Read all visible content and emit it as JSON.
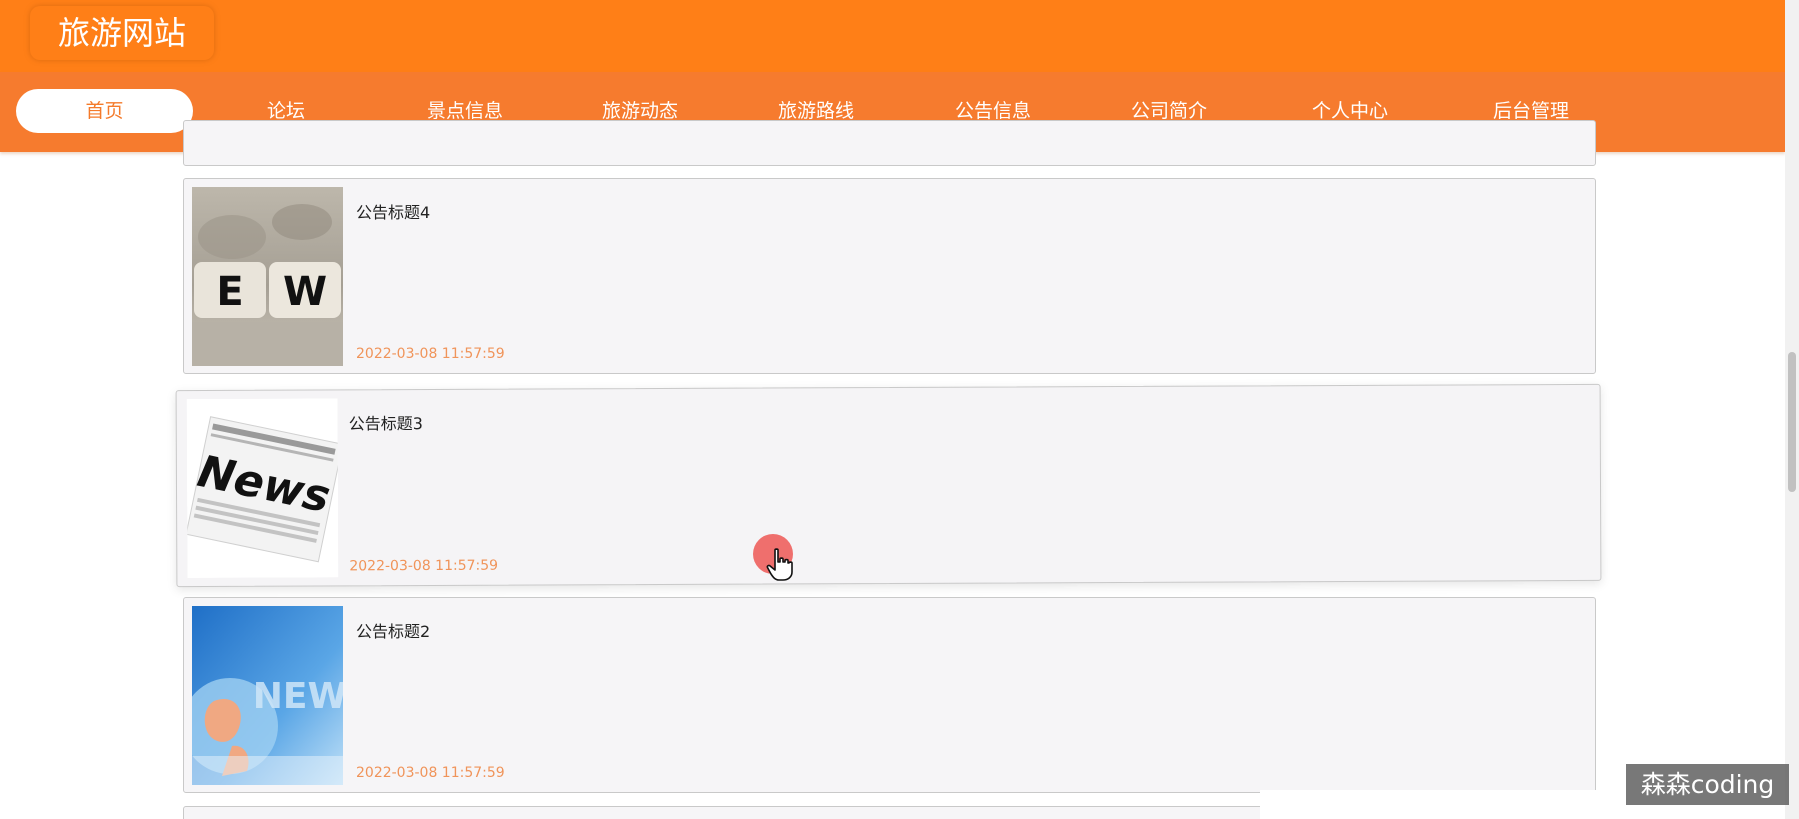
{
  "header": {
    "site_title": "旅游网站",
    "brand_color": "#ff7f17"
  },
  "nav": {
    "items": [
      {
        "label": "首页",
        "active": true
      },
      {
        "label": "论坛"
      },
      {
        "label": "景点信息"
      },
      {
        "label": "旅游动态"
      },
      {
        "label": "旅游路线"
      },
      {
        "label": "公告信息"
      },
      {
        "label": "公司简介"
      },
      {
        "label": "个人中心"
      },
      {
        "label": "后台管理"
      }
    ]
  },
  "notices": [
    {
      "title": "公告标题4",
      "date": "2022-03-08 11:57:59",
      "thumb": "news-dice-icon"
    },
    {
      "title": "公告标题3",
      "date": "2022-03-08 11:57:59",
      "thumb": "news-paper-icon"
    },
    {
      "title": "公告标题2",
      "date": "2022-03-08 11:57:59",
      "thumb": "news-globe-icon"
    }
  ],
  "watermark": "森森coding",
  "colors": {
    "nav_bg": "#f67b2e",
    "date_text": "#f0945a",
    "card_bg": "#f6f5f7"
  }
}
